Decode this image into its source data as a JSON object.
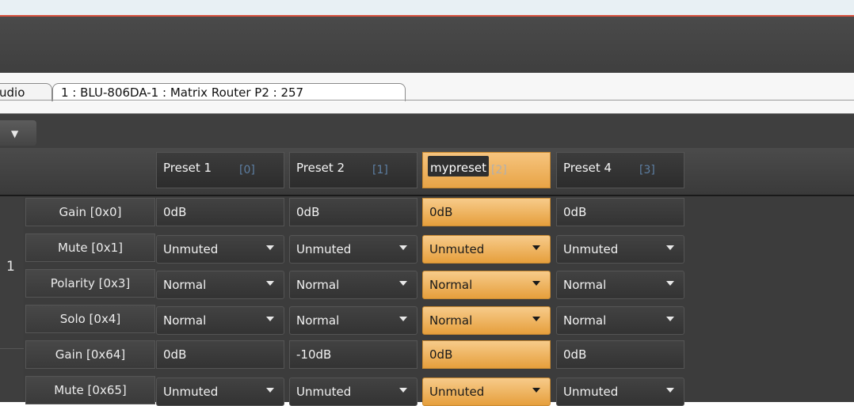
{
  "tabs": [
    "udio",
    "1 : BLU-806DA-1 : Matrix Router P2 : 257"
  ],
  "channel_number": "1",
  "columns": [
    {
      "name": "Preset 1",
      "index": "[0]",
      "selected": false
    },
    {
      "name": "Preset 2",
      "index": "[1]",
      "selected": false
    },
    {
      "name": "mypreset",
      "index": "[2]",
      "selected": true
    },
    {
      "name": "Preset 4",
      "index": "[3]",
      "selected": false
    }
  ],
  "rows": [
    {
      "label": "Gain [0x0]",
      "type": "text",
      "values": [
        "0dB",
        "0dB",
        "0dB",
        "0dB"
      ]
    },
    {
      "label": "Mute [0x1]",
      "type": "dropdown",
      "values": [
        "Unmuted",
        "Unmuted",
        "Unmuted",
        "Unmuted"
      ]
    },
    {
      "label": "Polarity [0x3]",
      "type": "dropdown",
      "values": [
        "Normal",
        "Normal",
        "Normal",
        "Normal"
      ]
    },
    {
      "label": "Solo [0x4]",
      "type": "dropdown",
      "values": [
        "Normal",
        "Normal",
        "Normal",
        "Normal"
      ]
    },
    {
      "label": "Gain [0x64]",
      "type": "text",
      "values": [
        "0dB",
        "-10dB",
        "0dB",
        "0dB"
      ]
    },
    {
      "label": "Mute [0x65]",
      "type": "dropdown",
      "values": [
        "Unmuted",
        "Unmuted",
        "Unmuted",
        "Unmuted"
      ]
    }
  ],
  "colors": {
    "accent": "#f0b45a",
    "panel": "#3c3c3c",
    "index_text": "#5d7fa3"
  }
}
